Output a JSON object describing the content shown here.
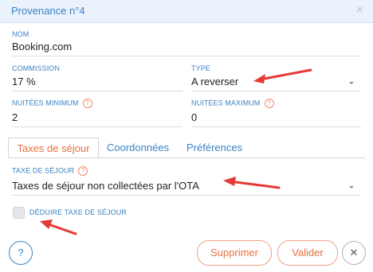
{
  "dialog": {
    "title": "Provenance n°4"
  },
  "fields": {
    "nom": {
      "label": "NOM",
      "value": "Booking.com"
    },
    "commission": {
      "label": "COMMISSION",
      "value": "17 %"
    },
    "type": {
      "label": "TYPE",
      "value": "A reverser"
    },
    "nuitees_min": {
      "label": "NUITÉES MINIMUM",
      "value": "2"
    },
    "nuitees_max": {
      "label": "NUITÉES MAXIMUM",
      "value": "0"
    },
    "taxe_sejour": {
      "label": "TAXE DE SÉJOUR",
      "value": "Taxes de séjour non collectées par l'OTA"
    },
    "deduire": {
      "label": "DÉDUIRE TAXE DE SÉJOUR",
      "checked": false
    }
  },
  "help_glyph": "?",
  "tabs": [
    {
      "label": "Taxes de séjour",
      "active": true
    },
    {
      "label": "Coordonnées",
      "active": false
    },
    {
      "label": "Préférences",
      "active": false
    }
  ],
  "buttons": {
    "help": "?",
    "delete": "Supprimer",
    "validate": "Valider",
    "close": "✕"
  },
  "colors": {
    "accent_blue": "#3b82c4",
    "accent_orange": "#e8703f",
    "annotation_red": "#e53935"
  },
  "icons": [
    "close-icon",
    "help-icon",
    "chevron-down-icon",
    "arrow-annotation"
  ]
}
